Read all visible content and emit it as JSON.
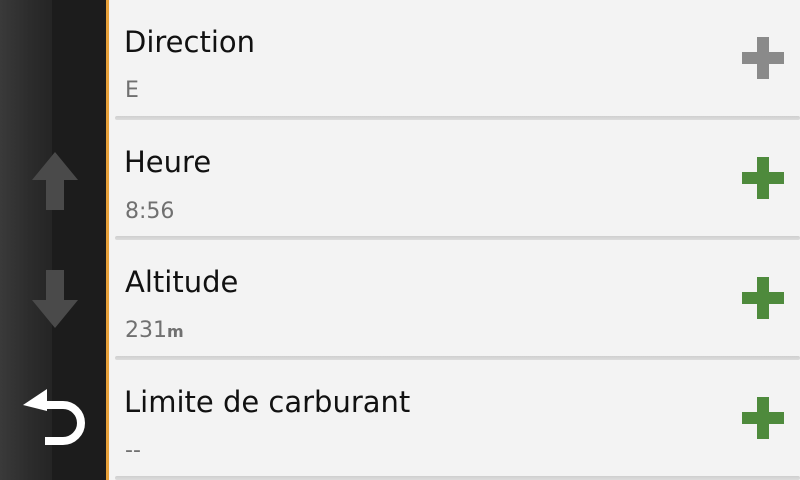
{
  "colors": {
    "rail": "#222222",
    "accent": "#e8a13a",
    "plus_enabled": "#4e8a3c",
    "plus_disabled": "#8a8a8a",
    "list_background": "#f3f3f3"
  },
  "nav": {
    "up_icon": "arrow-up-icon",
    "down_icon": "arrow-down-icon",
    "back_icon": "back-arrow-icon"
  },
  "items": [
    {
      "title": "Direction",
      "value": "E",
      "unit": "",
      "add_icon": "plus-icon",
      "add_enabled": false
    },
    {
      "title": "Heure",
      "value": "8:56",
      "unit": "",
      "add_icon": "plus-icon",
      "add_enabled": true
    },
    {
      "title": "Altitude",
      "value": "231",
      "unit": "m",
      "add_icon": "plus-icon",
      "add_enabled": true
    },
    {
      "title": "Limite de carburant",
      "value": "--",
      "unit": "",
      "add_icon": "plus-icon",
      "add_enabled": true
    }
  ]
}
